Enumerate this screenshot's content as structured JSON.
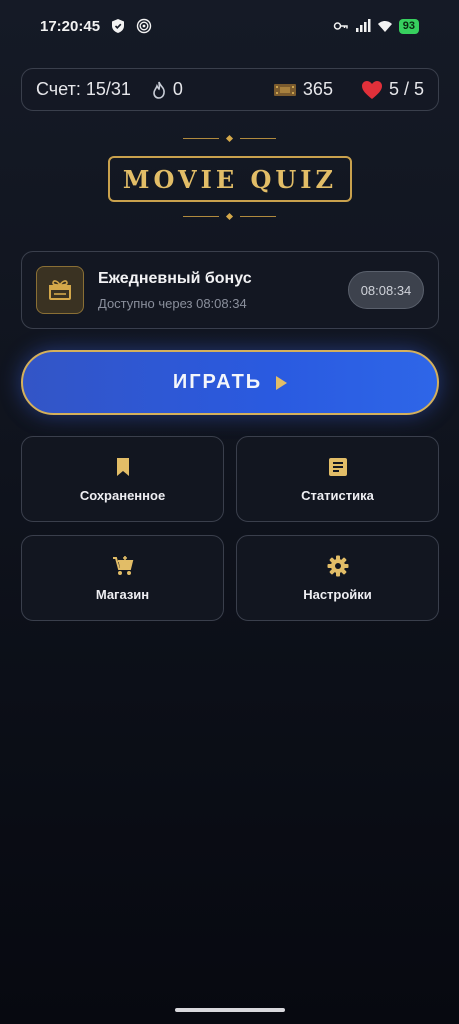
{
  "status_bar": {
    "time": "17:20:45",
    "battery": "93"
  },
  "stats": {
    "score": "Счет: 15/31",
    "streak": "0",
    "tickets": "365",
    "lives": "5 / 5"
  },
  "logo": {
    "title": "MOVIE QUIZ"
  },
  "bonus": {
    "title": "Ежедневный бонус",
    "subtitle": "Доступно через 08:08:34",
    "timer": "08:08:34",
    "icon": "gift-icon"
  },
  "play": {
    "label": "ИГРАТЬ"
  },
  "menu": {
    "saved": {
      "label": "Сохраненное",
      "icon": "bookmark-icon"
    },
    "stats": {
      "label": "Статистика",
      "icon": "document-icon"
    },
    "shop": {
      "label": "Магазин",
      "icon": "cart-icon"
    },
    "settings": {
      "label": "Настройки",
      "icon": "gear-icon"
    }
  },
  "colors": {
    "accent_gold": "#d4b05c",
    "play_blue": "#2a5ae0",
    "background": "#0f131d"
  }
}
